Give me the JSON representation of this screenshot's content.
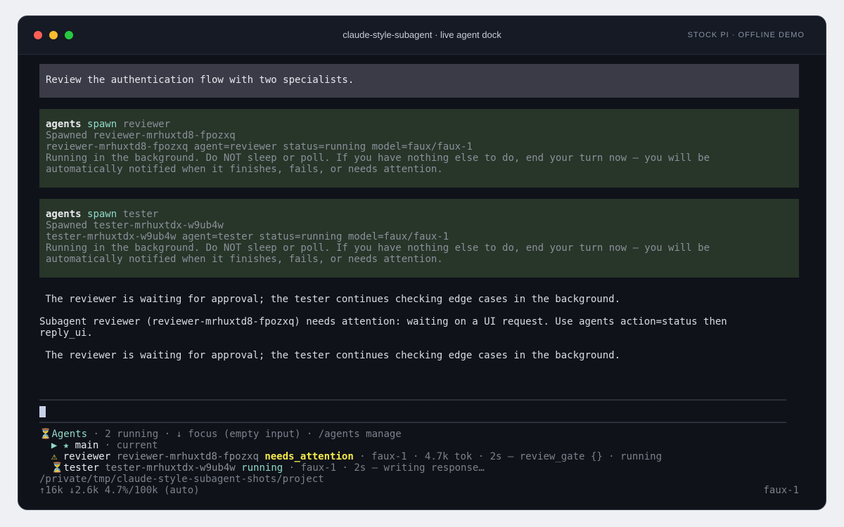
{
  "window": {
    "title": "claude-style-subagent · live agent dock",
    "badge": "STOCK PI · OFFLINE DEMO"
  },
  "user_message": "Review the authentication flow with two specialists.",
  "tool_calls": [
    {
      "cmd": "agents",
      "verb": "spawn",
      "arg": "reviewer",
      "lines": [
        "Spawned reviewer-mrhuxtd8-fpozxq",
        "reviewer-mrhuxtd8-fpozxq agent=reviewer status=running model=faux/faux-1",
        "Running in the background. Do NOT sleep or poll. If you have nothing else to do, end your turn now — you will be",
        "automatically notified when it finishes, fails, or needs attention."
      ]
    },
    {
      "cmd": "agents",
      "verb": "spawn",
      "arg": "tester",
      "lines": [
        "Spawned tester-mrhuxtdx-w9ub4w",
        "tester-mrhuxtdx-w9ub4w agent=tester status=running model=faux/faux-1",
        "Running in the background. Do NOT sleep or poll. If you have nothing else to do, end your turn now — you will be",
        "automatically notified when it finishes, fails, or needs attention."
      ]
    }
  ],
  "assistant_message_1": " The reviewer is waiting for approval; the tester continues checking edge cases in the background.",
  "notification_lines": [
    "Subagent reviewer (reviewer-mrhuxtd8-fpozxq) needs attention: waiting on a UI request. Use agents action=status then",
    "reply_ui."
  ],
  "assistant_message_2": " The reviewer is waiting for approval; the tester continues checking edge cases in the background.",
  "separator": "──────────────────────────────────────────────────────────────────────────────────────────────────────────────────────────────",
  "dock": {
    "header_icon": "⏳",
    "header_title": "Agents",
    "header_meta": " · 2 running · ↓ focus (empty input) · /agents manage",
    "main_row": {
      "prefix": "  ▶ ★ ",
      "name": "main",
      "meta": " · current"
    },
    "reviewer_row": {
      "prefix": "  ⚠ ",
      "name": "reviewer",
      "id": " reviewer-mrhuxtd8-fpozxq ",
      "status": "needs_attention",
      "meta": " · faux-1 · 4.7k tok · 2s — review_gate {} · running"
    },
    "tester_row": {
      "prefix": "  ⏳",
      "name": "tester",
      "id": " tester-mrhuxtdx-w9ub4w ",
      "status": "running",
      "meta": " · faux-1 · 2s — writing response…"
    }
  },
  "footer": {
    "path": "/private/tmp/claude-style-subagent-shots/project",
    "stats": "↑16k ↓2.6k 4.7%/100k (auto)",
    "model": "faux-1"
  },
  "colors": {
    "background": "#0f1219",
    "user_block": "#3a3b46",
    "tool_block": "#283529",
    "accent_cyan": "#8fd9c9",
    "attention_yellow": "#f5e94b"
  }
}
